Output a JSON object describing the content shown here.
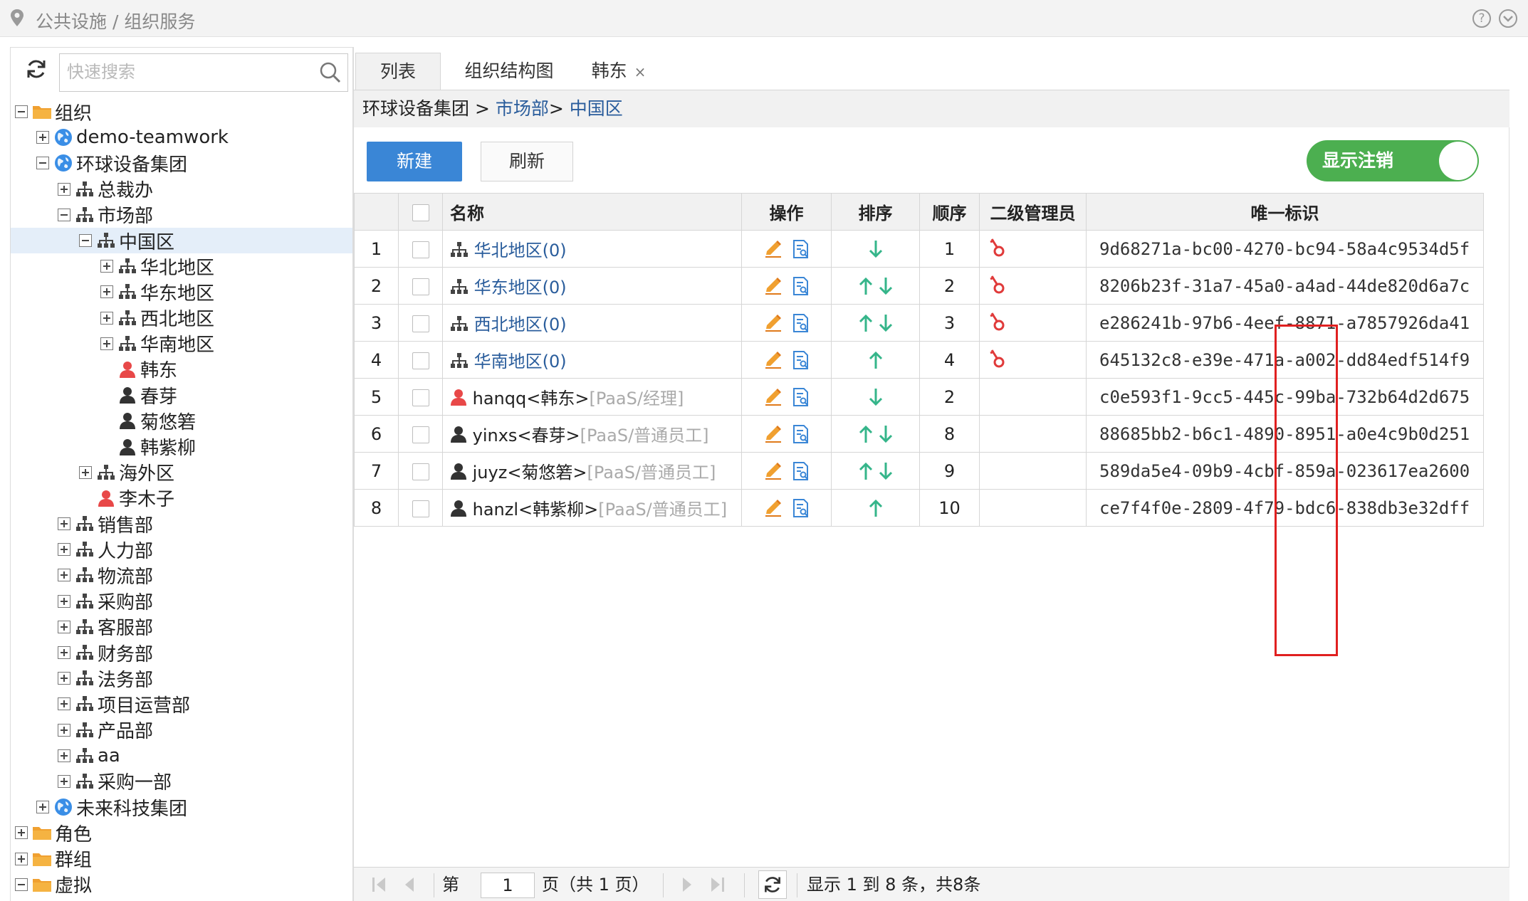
{
  "topbar": {
    "breadcrumb": "公共设施 / 组织服务",
    "help_label": "?"
  },
  "search": {
    "placeholder": "快速搜索"
  },
  "tree": [
    {
      "label": "组织",
      "indent": 0,
      "exp": "minus",
      "icon": "folder-icon"
    },
    {
      "label": "demo-teamwork",
      "indent": 1,
      "exp": "plus",
      "icon": "globe-icon"
    },
    {
      "label": "环球设备集团",
      "indent": 1,
      "exp": "minus",
      "icon": "globe-icon"
    },
    {
      "label": "总裁办",
      "indent": 2,
      "exp": "plus",
      "icon": "org-icon"
    },
    {
      "label": "市场部",
      "indent": 2,
      "exp": "minus",
      "icon": "org-icon"
    },
    {
      "label": "中国区",
      "indent": 3,
      "exp": "minus",
      "icon": "org-icon",
      "selected": true
    },
    {
      "label": "华北地区",
      "indent": 4,
      "exp": "plus",
      "icon": "org-icon"
    },
    {
      "label": "华东地区",
      "indent": 4,
      "exp": "plus",
      "icon": "org-icon"
    },
    {
      "label": "西北地区",
      "indent": 4,
      "exp": "plus",
      "icon": "org-icon"
    },
    {
      "label": "华南地区",
      "indent": 4,
      "exp": "plus",
      "icon": "org-icon"
    },
    {
      "label": "韩东",
      "indent": 4,
      "exp": "none",
      "icon": "user-red-icon"
    },
    {
      "label": "春芽",
      "indent": 4,
      "exp": "none",
      "icon": "user-icon"
    },
    {
      "label": "菊悠箬",
      "indent": 4,
      "exp": "none",
      "icon": "user-icon"
    },
    {
      "label": "韩紫柳",
      "indent": 4,
      "exp": "none",
      "icon": "user-icon"
    },
    {
      "label": "海外区",
      "indent": 3,
      "exp": "plus",
      "icon": "org-icon"
    },
    {
      "label": "李木子",
      "indent": 3,
      "exp": "none",
      "icon": "user-red-icon"
    },
    {
      "label": "销售部",
      "indent": 2,
      "exp": "plus",
      "icon": "org-icon"
    },
    {
      "label": "人力部",
      "indent": 2,
      "exp": "plus",
      "icon": "org-icon"
    },
    {
      "label": "物流部",
      "indent": 2,
      "exp": "plus",
      "icon": "org-icon"
    },
    {
      "label": "采购部",
      "indent": 2,
      "exp": "plus",
      "icon": "org-icon"
    },
    {
      "label": "客服部",
      "indent": 2,
      "exp": "plus",
      "icon": "org-icon"
    },
    {
      "label": "财务部",
      "indent": 2,
      "exp": "plus",
      "icon": "org-icon"
    },
    {
      "label": "法务部",
      "indent": 2,
      "exp": "plus",
      "icon": "org-icon"
    },
    {
      "label": "项目运营部",
      "indent": 2,
      "exp": "plus",
      "icon": "org-icon"
    },
    {
      "label": "产品部",
      "indent": 2,
      "exp": "plus",
      "icon": "org-icon"
    },
    {
      "label": "aa",
      "indent": 2,
      "exp": "plus",
      "icon": "org-icon"
    },
    {
      "label": "采购一部",
      "indent": 2,
      "exp": "plus",
      "icon": "org-icon"
    },
    {
      "label": "未来科技集团",
      "indent": 1,
      "exp": "plus",
      "icon": "globe-icon"
    },
    {
      "label": "角色",
      "indent": 0,
      "exp": "plus",
      "icon": "folder-icon"
    },
    {
      "label": "群组",
      "indent": 0,
      "exp": "plus",
      "icon": "folder-icon"
    },
    {
      "label": "虚拟",
      "indent": 0,
      "exp": "minus",
      "icon": "folder-icon"
    }
  ],
  "tabs": [
    {
      "label": "列表",
      "active": true
    },
    {
      "label": "组织结构图",
      "active": false
    },
    {
      "label": "韩东",
      "active": false,
      "close": "×"
    }
  ],
  "path": {
    "root": "环球设备集团 > ",
    "link1": "市场部",
    "sep": "> ",
    "link2": "中国区"
  },
  "toolbar": {
    "new_label": "新建",
    "refresh_label": "刷新",
    "toggle_label": "显示注销",
    "toggle_on": true
  },
  "table": {
    "headers": {
      "name": "名称",
      "ops": "操作",
      "sort": "排序",
      "order": "顺序",
      "admin": "二级管理员",
      "uid": "唯一标识"
    },
    "rows": [
      {
        "num": "1",
        "type": "org",
        "name": "华北地区(0)",
        "role": "",
        "sort": [
          "down"
        ],
        "order": "1",
        "admin": true,
        "uid": "9d68271a-bc00-4270-bc94-58a4c9534d5f"
      },
      {
        "num": "2",
        "type": "org",
        "name": "华东地区(0)",
        "role": "",
        "sort": [
          "up",
          "down"
        ],
        "order": "2",
        "admin": true,
        "uid": "8206b23f-31a7-45a0-a4ad-44de820d6a7c"
      },
      {
        "num": "3",
        "type": "org",
        "name": "西北地区(0)",
        "role": "",
        "sort": [
          "up",
          "down"
        ],
        "order": "3",
        "admin": true,
        "uid": "e286241b-97b6-4eef-8871-a7857926da41"
      },
      {
        "num": "4",
        "type": "org",
        "name": "华南地区(0)",
        "role": "",
        "sort": [
          "up"
        ],
        "order": "4",
        "admin": true,
        "uid": "645132c8-e39e-471a-a002-dd84edf514f9"
      },
      {
        "num": "5",
        "type": "user-red",
        "name": "hanqq<韩东>",
        "role": "[PaaS/经理]",
        "sort": [
          "down"
        ],
        "order": "2",
        "admin": false,
        "uid": "c0e593f1-9cc5-445c-99ba-732b64d2d675"
      },
      {
        "num": "6",
        "type": "user",
        "name": "yinxs<春芽>",
        "role": "[PaaS/普通员工]",
        "sort": [
          "up",
          "down"
        ],
        "order": "8",
        "admin": false,
        "uid": "88685bb2-b6c1-4890-8951-a0e4c9b0d251"
      },
      {
        "num": "7",
        "type": "user",
        "name": "juyz<菊悠箬>",
        "role": "[PaaS/普通员工]",
        "sort": [
          "up",
          "down"
        ],
        "order": "9",
        "admin": false,
        "uid": "589da5e4-09b9-4cbf-859a-023617ea2600"
      },
      {
        "num": "8",
        "type": "user",
        "name": "hanzl<韩紫柳>",
        "role": "[PaaS/普通员工]",
        "sort": [
          "up"
        ],
        "order": "10",
        "admin": false,
        "uid": "ce7f4f0e-2809-4f79-bdc6-838db3e32dff"
      }
    ]
  },
  "pager": {
    "page_prefix": "第",
    "page_value": "1",
    "page_suffix": "页（共 1 页）",
    "summary": "显示 1 到 8 条，共8条"
  },
  "colors": {
    "accent": "#3a86d6",
    "link": "#2a5d9c",
    "toggle": "#4caf50",
    "sort_arrow": "#35b58a",
    "highlight": "#e02020"
  }
}
